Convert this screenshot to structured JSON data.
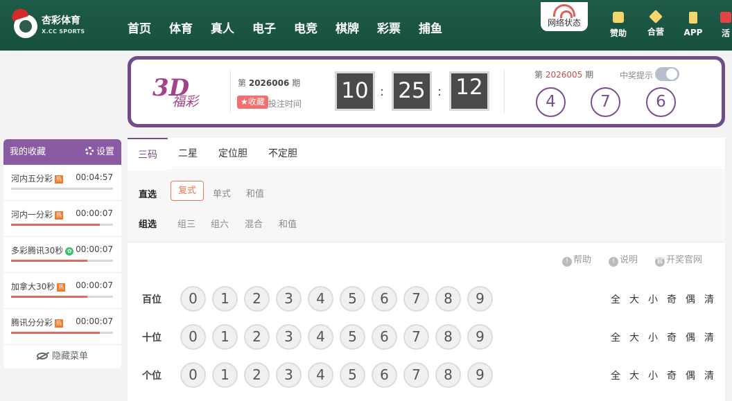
{
  "header": {
    "logo_text": "杏彩体育",
    "logo_sub": "X.CC SPORTS",
    "nav": [
      "首页",
      "体育",
      "真人",
      "电子",
      "电竞",
      "棋牌",
      "彩票",
      "捕鱼"
    ],
    "network_status": "网络状态",
    "quick_links": [
      "赞助",
      "合营",
      "APP",
      "活"
    ]
  },
  "lottery": {
    "brand_3d": "3D",
    "brand_name": "福彩",
    "current_issue_prefix": "第",
    "current_issue_no": "2026006",
    "current_issue_suffix": "期",
    "favorite_label": "收藏",
    "bet_time_label": "投注时间",
    "countdown": {
      "h": "10",
      "m": "25",
      "s": "12"
    },
    "prev_issue_prefix": "第",
    "prev_issue_no": "2026005",
    "prev_issue_suffix": "期",
    "result_balls": [
      "4",
      "7",
      "6"
    ],
    "notify_label": "中奖提示",
    "notify_on": false
  },
  "sidebar": {
    "title": "我的收藏",
    "settings_label": "设置",
    "items": [
      {
        "name": "河内五分彩",
        "tag": "热",
        "tag_color": "#ef7b2f",
        "time": "00:04:57",
        "progress": 0
      },
      {
        "name": "河内一分彩",
        "tag": "热",
        "tag_color": "#ef7b2f",
        "time": "00:00:07",
        "progress": 0.87
      },
      {
        "name": "多彩腾讯30秒",
        "tag": "✿",
        "tag_color": "#3ac26e",
        "time": "00:00:07",
        "progress": 0.75
      },
      {
        "name": "加拿大30秒",
        "tag": "热",
        "tag_color": "#ef7b2f",
        "time": "00:00:07",
        "progress": 0.75
      },
      {
        "name": "腾讯分分彩",
        "tag": "热",
        "tag_color": "#ef7b2f",
        "time": "00:00:07",
        "progress": 0.87
      }
    ],
    "hide_menu": "隐藏菜单"
  },
  "tabs": [
    "三码",
    "二星",
    "定位胆",
    "不定胆"
  ],
  "sub": {
    "direct_label": "直选",
    "direct_options": [
      "复式",
      "单式",
      "和值"
    ],
    "group_label": "组选",
    "group_options": [
      "组三",
      "组六",
      "混合",
      "和值"
    ]
  },
  "help": {
    "help": "帮助",
    "explain": "说明",
    "official": "开奖官网"
  },
  "rows": [
    "百位",
    "十位",
    "个位"
  ],
  "digits": [
    "0",
    "1",
    "2",
    "3",
    "4",
    "5",
    "6",
    "7",
    "8",
    "9"
  ],
  "quick_filters": [
    "全",
    "大",
    "小",
    "奇",
    "偶",
    "清"
  ],
  "colors": {
    "header_green": "#1e5b47",
    "brand_purple": "#7a4d92",
    "accent_orange": "#e7774e"
  }
}
